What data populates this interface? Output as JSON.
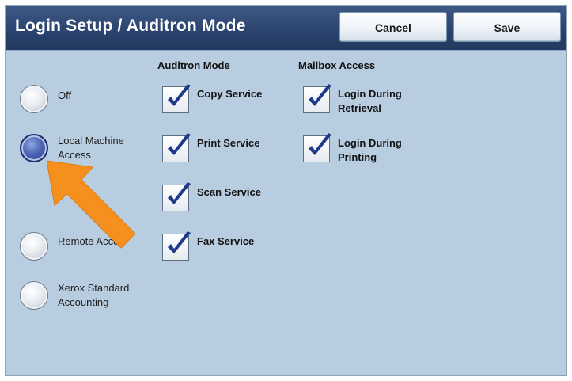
{
  "header": {
    "title": "Login Setup / Auditron Mode",
    "cancel_label": "Cancel",
    "save_label": "Save"
  },
  "login_modes": [
    {
      "label_line1": "Off",
      "label_line2": "",
      "selected": false
    },
    {
      "label_line1": "Local Machine",
      "label_line2": "Access",
      "selected": true
    },
    {
      "label_line1": "Remote Acce",
      "label_line2": "",
      "selected": false
    },
    {
      "label_line1": "Xerox Standard",
      "label_line2": "Accounting",
      "selected": false
    }
  ],
  "auditron_mode": {
    "header": "Auditron Mode",
    "items": [
      {
        "label": "Copy Service",
        "checked": true
      },
      {
        "label": "Print Service",
        "checked": true
      },
      {
        "label": "Scan Service",
        "checked": true
      },
      {
        "label": "Fax Service",
        "checked": true
      }
    ]
  },
  "mailbox_access": {
    "header": "Mailbox Access",
    "items": [
      {
        "label_line1": "Login During",
        "label_line2": "Retrieval",
        "checked": true
      },
      {
        "label_line1": "Login During",
        "label_line2": "Printing",
        "checked": true
      }
    ]
  },
  "colors": {
    "panel_bg": "#b9cde0",
    "titlebar": "#2b4470",
    "checkmark": "#1f3a8a",
    "selected_radio": "#3e56a8",
    "annotation_arrow": "#f5901e"
  },
  "icons": {
    "radio": "radio-button",
    "checkbox": "checkbox-checked",
    "annotation": "arrow-pointer"
  }
}
